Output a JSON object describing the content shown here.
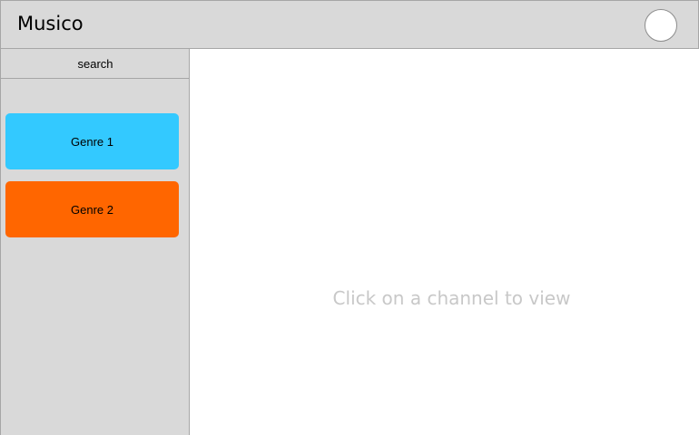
{
  "header": {
    "title": "Musico",
    "avatar_icon": "user-avatar-icon"
  },
  "sidebar": {
    "search_label": "search",
    "genres": [
      {
        "label": "Genre 1",
        "color": "#33c9ff"
      },
      {
        "label": "Genre 2",
        "color": "#ff6600"
      }
    ]
  },
  "main": {
    "empty_message": "Click on a channel to view"
  },
  "colors": {
    "chrome": "#d9d9d9",
    "border": "#a6a6a6",
    "placeholder_text": "#c8c8c8"
  }
}
